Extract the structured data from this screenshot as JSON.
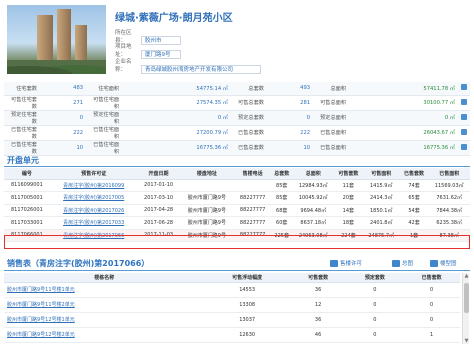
{
  "project": {
    "title": "绿城·紫薇广场·朗月苑小区",
    "district_label": "所在区县：",
    "district": "胶州市",
    "address_label": "项目地址：",
    "address": "厦门路9号",
    "company_label": "企业名称：",
    "company": "青岛绿城胶州湾房地产开发有限公司"
  },
  "stats": [
    {
      "l1": "住宅套数",
      "v1": "483",
      "l2": "住宅面积",
      "v2": "54775.14 ㎡",
      "l3": "总套数",
      "v3": "493",
      "l4": "总面积",
      "v4": "57411.78 ㎡"
    },
    {
      "l1": "可售住宅套数",
      "v1": "271",
      "l2": "可售住宅面积",
      "v2": "27574.35 ㎡",
      "l3": "可售总套数",
      "v3": "281",
      "l4": "可售总面积",
      "v4": "30100.77 ㎡"
    },
    {
      "l1": "预定住宅套数",
      "v1": "0",
      "l2": "预定住宅面积",
      "v2": "0 ㎡",
      "l3": "预定总套数",
      "v3": "0",
      "l4": "预定总面积",
      "v4": "0 ㎡"
    },
    {
      "l1": "已售住宅套数",
      "v1": "222",
      "l2": "已售住宅面积",
      "v2": "27200.79 ㎡",
      "l3": "已售总套数",
      "v3": "222",
      "l4": "已售总面积",
      "v4": "26043.67 ㎡"
    },
    {
      "l1": "已售住宅套数",
      "v1": "10",
      "l2": "已售住宅面积",
      "v2": "16775.36 ㎡",
      "l3": "已售总套数",
      "v3": "10",
      "l4": "已售总面积",
      "v4": "16775.36 ㎡"
    }
  ],
  "units_section": {
    "title": "开盘单元",
    "headers": [
      "编号",
      "预售许可证",
      "开盘日期",
      "楼盘地址",
      "售楼电话",
      "总套数",
      "总面积",
      "可售套数",
      "可售面积",
      "已售套数",
      "已售面积"
    ],
    "rows": [
      [
        "8116099001",
        "青房注字(胶州)第2016099",
        "2017-01-10",
        "",
        "",
        "85套",
        "12984.93㎡",
        "11套",
        "1415.9㎡",
        "74套",
        "11569.03㎡"
      ],
      [
        "8117005001",
        "青房注字(胶州)第2017005",
        "2017-03-10",
        "胶州市厦门路9号",
        "88227777",
        "85套",
        "10045.92㎡",
        "20套",
        "2414.3㎡",
        "65套",
        "7631.62㎡"
      ],
      [
        "8117026001",
        "青房注字(胶州)第2017026",
        "2017-04-28",
        "胶州市厦门路9号",
        "88227777",
        "68套",
        "9694.48㎡",
        "14套",
        "1850.1㎡",
        "54套",
        "7844.38㎡"
      ],
      [
        "8117033001",
        "青房注字(胶州)第2017033",
        "2017-06-28",
        "胶州市厦门路9号",
        "88227777",
        "60套",
        "8637.18㎡",
        "18套",
        "2401.8㎡",
        "42套",
        "6235.38㎡"
      ],
      [
        "8117066001",
        "青房注字(胶州)第2017066",
        "2017-11-03",
        "胶州市厦门路9号",
        "88227777",
        "225套",
        "24963.08㎡",
        "224套",
        "24875.7㎡",
        "1套",
        "87.38㎡"
      ]
    ]
  },
  "sales_section": {
    "title": "销售表（青房注字(胶州)第2017066）",
    "tool1": "售楼许可",
    "tool2": "总图",
    "tool3": "楼型图",
    "headers": [
      "楼栋名称",
      "可售浮动幅度",
      "可售套数",
      "预定套数",
      "已售套数"
    ],
    "rows": [
      [
        "胶州市厦门路9号11号楼1单元",
        "14553",
        "36",
        "0",
        "0"
      ],
      [
        "胶州市厦门路9号11号楼2单元",
        "13308",
        "12",
        "0",
        "0"
      ],
      [
        "胶州市厦门路9号12号楼1单元",
        "13037",
        "36",
        "0",
        "0"
      ],
      [
        "胶州市厦门路9号12号楼2单元",
        "12630",
        "46",
        "0",
        "1"
      ]
    ]
  },
  "colors": {
    "accent": "#2e74c0",
    "highlight": "#e03030"
  }
}
